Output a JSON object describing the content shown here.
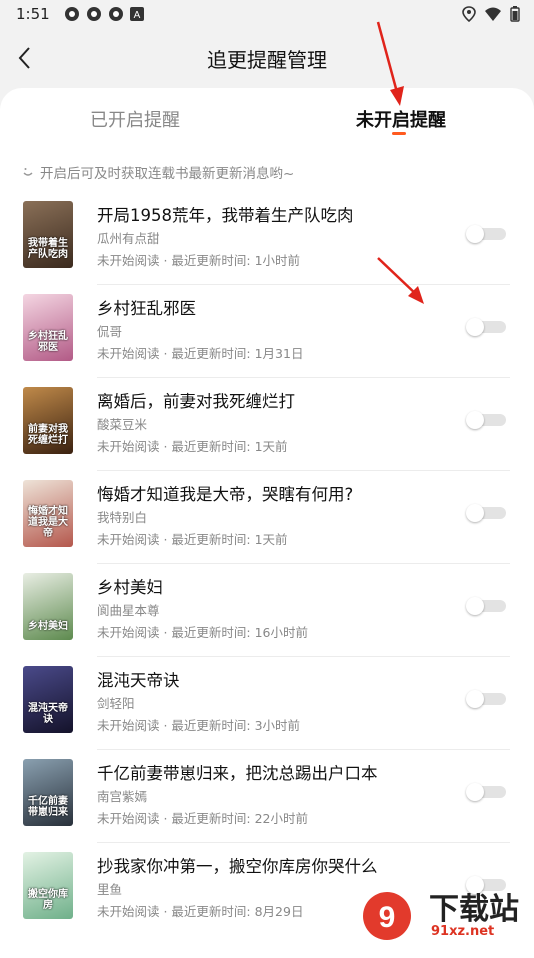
{
  "status": {
    "time": "1:51"
  },
  "header": {
    "title": "追更提醒管理"
  },
  "tabs": [
    {
      "label": "已开启提醒"
    },
    {
      "label": "未开启提醒"
    }
  ],
  "hint": "开启后可及时获取连载书最新更新消息哟~",
  "accent_color": "#ff5a1f",
  "books": [
    {
      "title": "开局1958荒年，我带着生产队吃肉",
      "author": "瓜州有点甜",
      "meta": "未开始阅读 · 最近更新时间: 1小时前",
      "cover_text": "我带着生产队吃肉",
      "cover_color": "#5b4a3a"
    },
    {
      "title": "乡村狂乱邪医",
      "author": "侃哥",
      "meta": "未开始阅读 · 最近更新时间: 1月31日",
      "cover_text": "乡村狂乱邪医",
      "cover_color": "#d27a9a"
    },
    {
      "title": "离婚后，前妻对我死缠烂打",
      "author": "酸菜豆米",
      "meta": "未开始阅读 · 最近更新时间: 1天前",
      "cover_text": "前妻对我死缠烂打",
      "cover_color": "#6a3f22"
    },
    {
      "title": "悔婚才知道我是大帝，哭瞎有何用?",
      "author": "我特别白",
      "meta": "未开始阅读 · 最近更新时间: 1天前",
      "cover_text": "悔婚才知道我是大帝",
      "cover_color": "#c9b7a6"
    },
    {
      "title": "乡村美妇",
      "author": "阆曲星本尊",
      "meta": "未开始阅读 · 最近更新时间: 16小时前",
      "cover_text": "乡村美妇",
      "cover_color": "#6c8f5a"
    },
    {
      "title": "混沌天帝诀",
      "author": "剑轻阳",
      "meta": "未开始阅读 · 最近更新时间: 3小时前",
      "cover_text": "混沌天帝诀",
      "cover_color": "#2c2a4a"
    },
    {
      "title": "千亿前妻带崽归来，把沈总踢出户口本",
      "author": "南宫紫嫣",
      "meta": "未开始阅读 · 最近更新时间: 22小时前",
      "cover_text": "千亿前妻带崽归来",
      "cover_color": "#3a4a5a"
    },
    {
      "title": "抄我家你冲第一，搬空你库房你哭什么",
      "author": "里鱼",
      "meta": "未开始阅读 · 最近更新时间: 8月29日",
      "cover_text": "搬空你库房",
      "cover_color": "#9fc7a8"
    }
  ],
  "watermark": {
    "text": "下载站",
    "url": "91xz.net"
  }
}
